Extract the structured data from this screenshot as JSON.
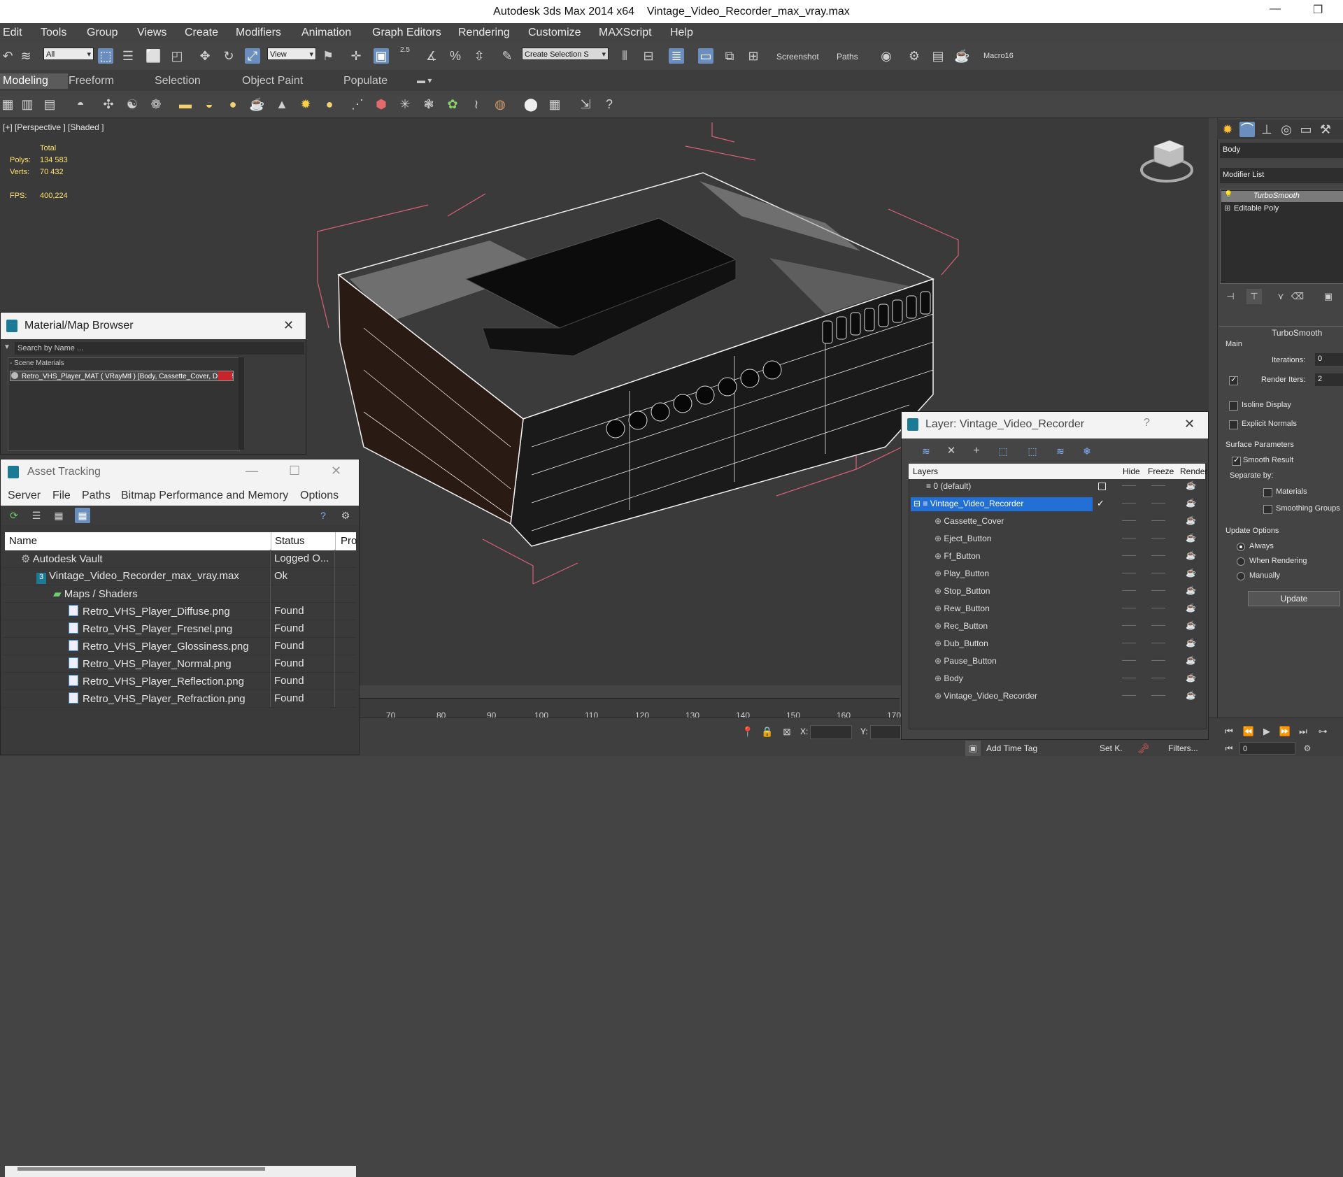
{
  "title_bar": {
    "app": "Autodesk 3ds Max  2014 x64",
    "file": "Vintage_Video_Recorder_max_vray.max"
  },
  "menu": [
    "Edit",
    "Tools",
    "Group",
    "Views",
    "Create",
    "Modifiers",
    "Animation",
    "Graph Editors",
    "Rendering",
    "Customize",
    "MAXScript",
    "Help"
  ],
  "toolbar": {
    "selection_filter": "All",
    "ref_coord": "View",
    "named_selection": "Create Selection S",
    "snap_value": "2.5",
    "screenshot_label": "Screenshot",
    "paths_label": "Paths",
    "macro_label": "Macro16"
  },
  "ribbon_tabs": [
    "Modeling",
    "Freeform",
    "Selection",
    "Object Paint",
    "Populate"
  ],
  "viewport": {
    "label": "[+] [Perspective ] [Shaded ]",
    "stats": {
      "total_label": "Total",
      "polys_label": "Polys:",
      "polys": "134 583",
      "verts_label": "Verts:",
      "verts": "70 432",
      "fps_label": "FPS:",
      "fps": "400,224"
    }
  },
  "material_browser": {
    "title": "Material/Map Browser",
    "search_placeholder": "Search by Name ...",
    "section": "- Scene Materials",
    "item": "Retro_VHS_Player_MAT ( VRayMtl ) [Body, Cassette_Cover, Dub_B..."
  },
  "asset_tracking": {
    "title": "Asset Tracking",
    "menu": [
      "Server",
      "File",
      "Paths",
      "Bitmap Performance and Memory",
      "Options"
    ],
    "columns": [
      "Name",
      "Status",
      "Pro"
    ],
    "rows": [
      {
        "name": "Autodesk Vault",
        "status": "Logged O..."
      },
      {
        "name": "Vintage_Video_Recorder_max_vray.max",
        "status": "Ok"
      },
      {
        "name": "Maps / Shaders",
        "status": ""
      },
      {
        "name": "Retro_VHS_Player_Diffuse.png",
        "status": "Found"
      },
      {
        "name": "Retro_VHS_Player_Fresnel.png",
        "status": "Found"
      },
      {
        "name": "Retro_VHS_Player_Glossiness.png",
        "status": "Found"
      },
      {
        "name": "Retro_VHS_Player_Normal.png",
        "status": "Found"
      },
      {
        "name": "Retro_VHS_Player_Reflection.png",
        "status": "Found"
      },
      {
        "name": "Retro_VHS_Player_Refraction.png",
        "status": "Found"
      }
    ]
  },
  "layer_window": {
    "title": "Layer: Vintage_Video_Recorder",
    "help": "?",
    "columns": [
      "Layers",
      "Hide",
      "Freeze",
      "Render"
    ],
    "layers": [
      {
        "name": "0 (default)",
        "depth": 0
      },
      {
        "name": "Vintage_Video_Recorder",
        "depth": 0,
        "selected": true
      },
      {
        "name": "Cassette_Cover",
        "depth": 1
      },
      {
        "name": "Eject_Button",
        "depth": 1
      },
      {
        "name": "Ff_Button",
        "depth": 1
      },
      {
        "name": "Play_Button",
        "depth": 1
      },
      {
        "name": "Stop_Button",
        "depth": 1
      },
      {
        "name": "Rew_Button",
        "depth": 1
      },
      {
        "name": "Rec_Button",
        "depth": 1
      },
      {
        "name": "Dub_Button",
        "depth": 1
      },
      {
        "name": "Pause_Button",
        "depth": 1
      },
      {
        "name": "Body",
        "depth": 1
      },
      {
        "name": "Vintage_Video_Recorder",
        "depth": 1
      }
    ]
  },
  "command_panel": {
    "object_name": "Body",
    "modifier_list": "Modifier List",
    "stack": [
      "TurboSmooth",
      "Editable Poly"
    ],
    "rollout_title": "TurboSmooth",
    "main_label": "Main",
    "iterations_label": "Iterations:",
    "iterations": "0",
    "render_iters_label": "Render Iters:",
    "render_iters": "2",
    "isoline": "Isoline Display",
    "explicit_normals": "Explicit Normals",
    "surface_params": "Surface Parameters",
    "smooth_result": "Smooth Result",
    "separate_by": "Separate by:",
    "materials": "Materials",
    "smoothing_groups": "Smoothing Groups",
    "update_options": "Update Options",
    "always": "Always",
    "when_rendering": "When Rendering",
    "manually": "Manually",
    "update_button": "Update"
  },
  "timeline": {
    "ticks": [
      "70",
      "80",
      "90",
      "100",
      "110",
      "120",
      "130",
      "140",
      "150",
      "160",
      "170"
    ]
  },
  "status_bar": {
    "x_label": "X:",
    "y_label": "Y:",
    "add_time_tag": "Add Time Tag",
    "set_key": "Set K.",
    "filters": "Filters...",
    "frame": "0"
  }
}
